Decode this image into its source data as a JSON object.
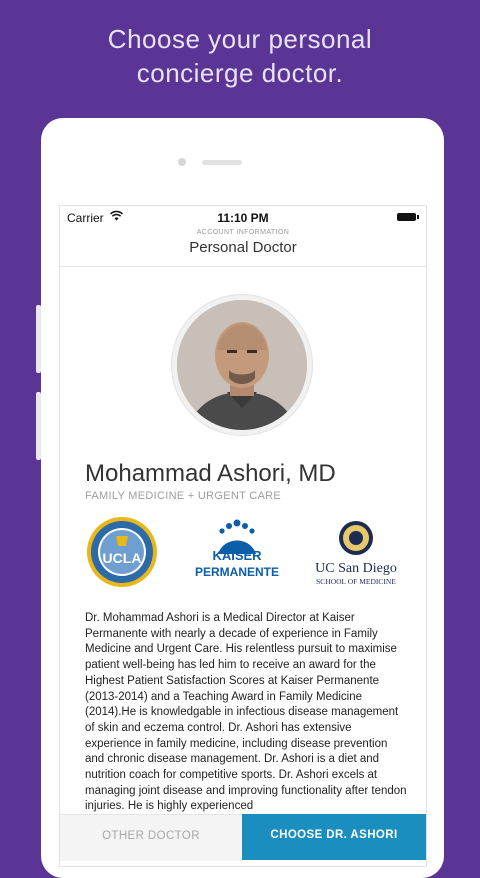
{
  "tagline": {
    "line1": "Choose your personal",
    "line2": "concierge doctor."
  },
  "status_bar": {
    "carrier": "Carrier",
    "time": "11:10 PM"
  },
  "nav": {
    "subtitle": "ACCOUNT INFORMATION",
    "title": "Personal Doctor"
  },
  "doctor": {
    "name": "Mohammad Ashori, MD",
    "specialty": "FAMILY MEDICINE + URGENT CARE",
    "bio": "Dr. Mohammad Ashori is a Medical Director at Kaiser Permanente with nearly a decade of experience in Family Medicine and Urgent Care. His relentless pursuit to maximise patient well-being has led him to receive an award for the Highest Patient Satisfaction Scores at Kaiser Permanente (2013-2014) and a Teaching Award in Family Medicine (2014).He is knowledgable in infectious disease management of skin and eczema control. Dr. Ashori has extensive experience in family medicine, including disease prevention and chronic disease management. Dr. Ashori is a diet and nutrition coach for competitive sports. Dr. Ashori excels at managing joint disease and improving functionality after tendon injuries. He is highly experienced"
  },
  "affiliations": {
    "ucla": {
      "text": "UCLA",
      "icon": "ucla-seal"
    },
    "kaiser": {
      "line1": "KAISER",
      "line2": "PERMANENTE",
      "icon": "kaiser-permanente-logo"
    },
    "ucsd": {
      "line1": "UC San Diego",
      "line2": "SCHOOL OF MEDICINE",
      "icon": "ucsd-seal"
    }
  },
  "buttons": {
    "other": "OTHER DOCTOR",
    "choose": "CHOOSE DR. ASHORI"
  },
  "colors": {
    "background": "#5a3596",
    "primary_button": "#1a8fbf"
  }
}
